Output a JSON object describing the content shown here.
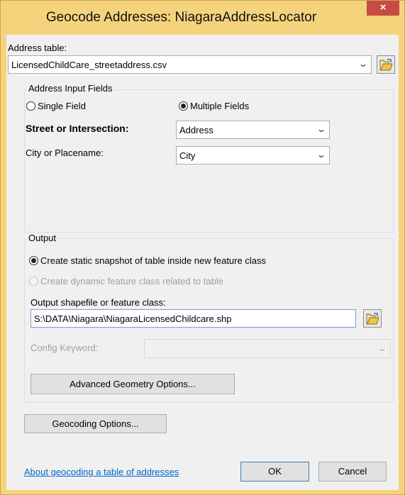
{
  "window": {
    "title": "Geocode Addresses:  NiagaraAddressLocator",
    "close_glyph": "×"
  },
  "address_table": {
    "label": "Address table:",
    "value": "LicensedChildCare_streetaddress.csv"
  },
  "address_input": {
    "group_title": "Address Input Fields",
    "single_field_label": "Single Field",
    "multiple_fields_label": "Multiple Fields",
    "selected": "Multiple Fields",
    "street_label": "Street or Intersection:",
    "street_value": "Address",
    "city_label": "City or Placename:",
    "city_value": "City"
  },
  "output": {
    "group_title": "Output",
    "static_option": "Create static snapshot of table inside new feature class",
    "dynamic_option": "Create dynamic feature class related to table",
    "selected": "static",
    "shapefile_label": "Output shapefile or feature class:",
    "shapefile_value": "S:\\DATA\\Niagara\\NiagaraLicensedChildcare.shp",
    "config_label": "Config Keyword:",
    "config_value": "",
    "advanced_button": "Advanced Geometry Options..."
  },
  "geocoding_options_button": "Geocoding Options...",
  "footer": {
    "help_link": "About geocoding a table of addresses",
    "ok": "OK",
    "cancel": "Cancel"
  },
  "icons": {
    "folder": "open-folder-icon",
    "dropdown": "chevron-down-icon"
  },
  "colors": {
    "titlebar": "#f4d37c",
    "close": "#c74b43",
    "link": "#0066cc"
  }
}
